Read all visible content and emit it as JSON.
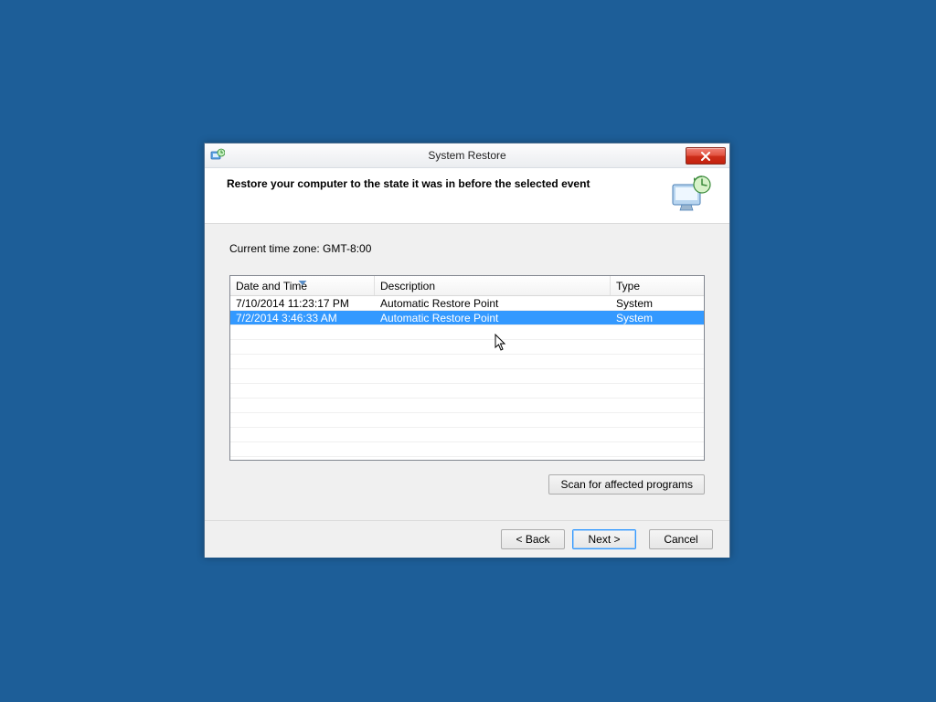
{
  "titlebar": {
    "title": "System Restore"
  },
  "header": {
    "text": "Restore your computer to the state it was in before the selected event"
  },
  "timezone_label": "Current time zone: GMT-8:00",
  "table": {
    "headers": {
      "date": "Date and Time",
      "desc": "Description",
      "type": "Type"
    },
    "rows": [
      {
        "date": "7/10/2014 11:23:17 PM",
        "desc": "Automatic Restore Point",
        "type": "System",
        "selected": false
      },
      {
        "date": "7/2/2014 3:46:33 AM",
        "desc": "Automatic Restore Point",
        "type": "System",
        "selected": true
      }
    ]
  },
  "buttons": {
    "scan": "Scan for affected programs",
    "back": "< Back",
    "next": "Next >",
    "cancel": "Cancel"
  }
}
